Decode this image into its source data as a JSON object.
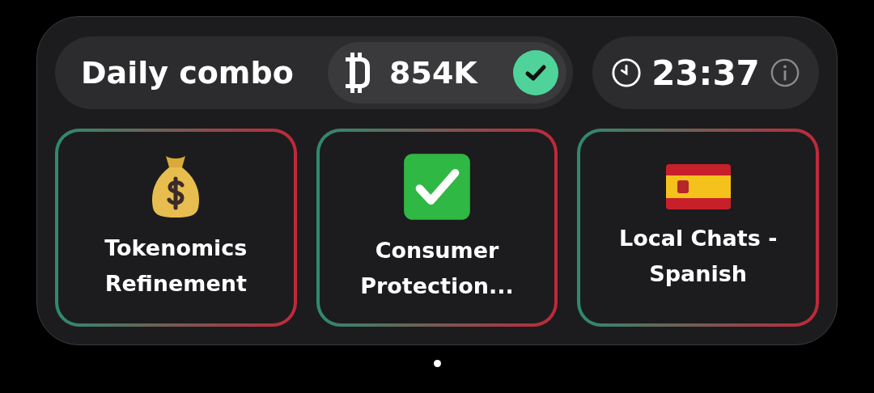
{
  "title": "Daily combo",
  "reward": {
    "amount": "854K",
    "claimed": true
  },
  "timer": {
    "time": "23:37"
  },
  "cards": [
    {
      "label": "Tokenomics Refinement"
    },
    {
      "label": "Consumer Protection..."
    },
    {
      "label": "Local Chats - Spanish"
    }
  ]
}
